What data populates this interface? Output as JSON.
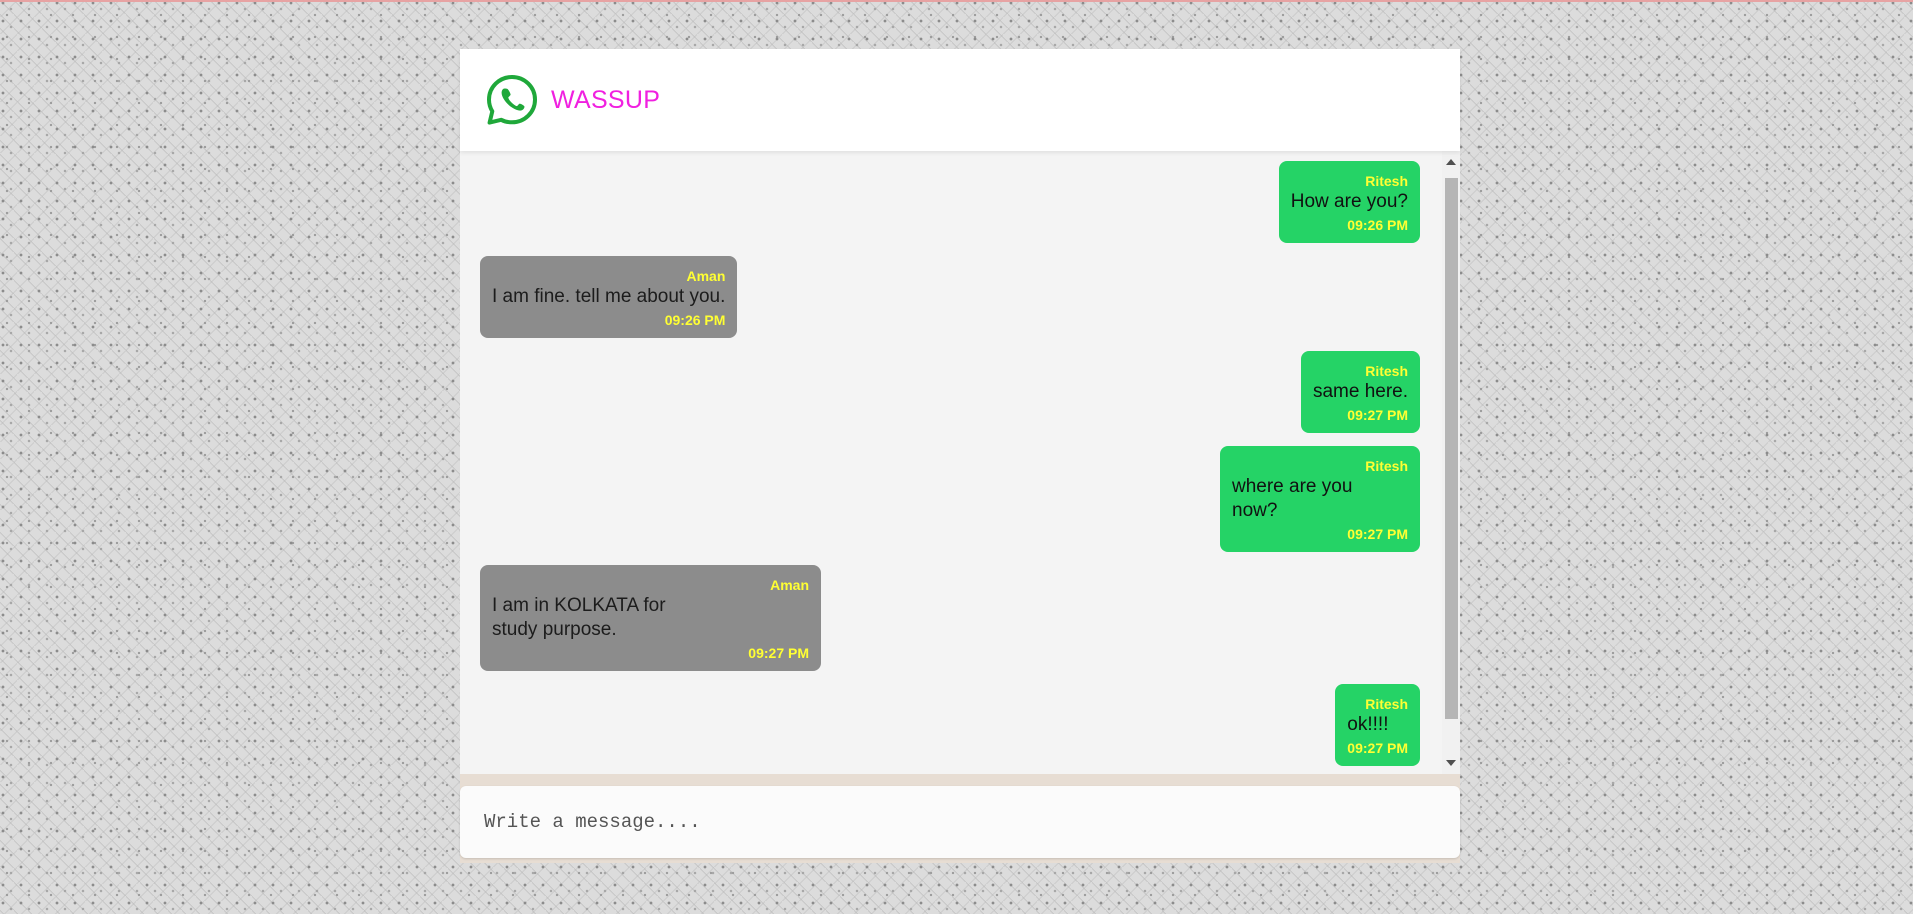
{
  "app": {
    "name": "WASSUP",
    "logo_icon": "whatsapp-logo-icon",
    "brand_color": "#f020e0",
    "accent_color": "#25d366"
  },
  "messages": [
    {
      "sender": "Ritesh",
      "text": "How are you?",
      "time": "09:26 PM",
      "direction": "sent"
    },
    {
      "sender": "Aman",
      "text": "I am fine. tell me about you.",
      "time": "09:26 PM",
      "direction": "received"
    },
    {
      "sender": "Ritesh",
      "text": "same here.",
      "time": "09:27 PM",
      "direction": "sent"
    },
    {
      "sender": "Ritesh",
      "text": "where are you now?",
      "time": "09:27 PM",
      "direction": "sent"
    },
    {
      "sender": "Aman",
      "text": "I am in KOLKATA for study purpose.",
      "time": "09:27 PM",
      "direction": "received"
    },
    {
      "sender": "Ritesh",
      "text": "ok!!!!",
      "time": "09:27 PM",
      "direction": "sent"
    }
  ],
  "composer": {
    "placeholder": "Write a message....",
    "value": ""
  }
}
